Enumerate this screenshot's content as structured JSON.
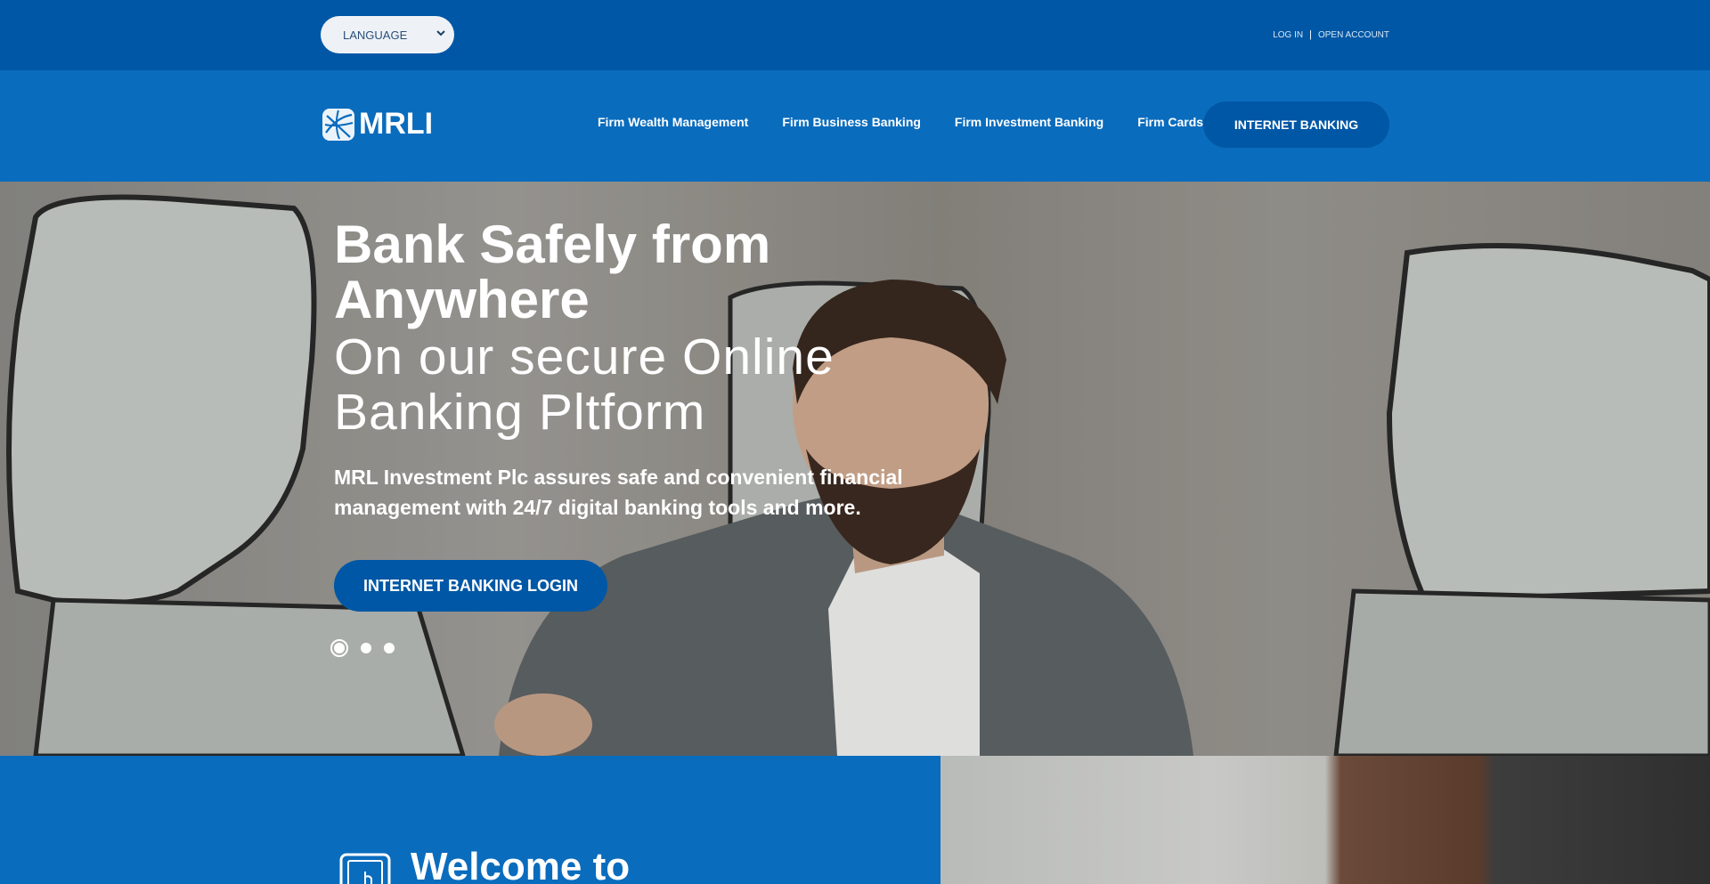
{
  "topbar": {
    "language_label": "LANGUAGE",
    "login_label": "LOG IN",
    "separator": "|",
    "open_account_label": "OPEN ACCOUNT"
  },
  "navbar": {
    "logo_text": "MRLI",
    "items": [
      {
        "label": "Firm Wealth Management"
      },
      {
        "label": "Firm Business Banking"
      },
      {
        "label": "Firm Investment Banking"
      },
      {
        "label": "Firm Cards"
      }
    ],
    "cta_label": "INTERNET BANKING"
  },
  "hero": {
    "title": "Bank Safely from Anywhere",
    "subtitle": "On our secure Online Banking Pltform",
    "description": "MRL Investment Plc assures safe and convenient financial management with 24/7 digital banking tools and more.",
    "button_label": "INTERNET BANKING LOGIN",
    "slides_count": 3,
    "active_slide": 1
  },
  "welcome": {
    "title": "Welcome to"
  },
  "colors": {
    "topbar_bg": "#0057a5",
    "navbar_bg": "#0a6cbd",
    "button_bg": "#0057a5",
    "text_light": "#ffffff"
  }
}
